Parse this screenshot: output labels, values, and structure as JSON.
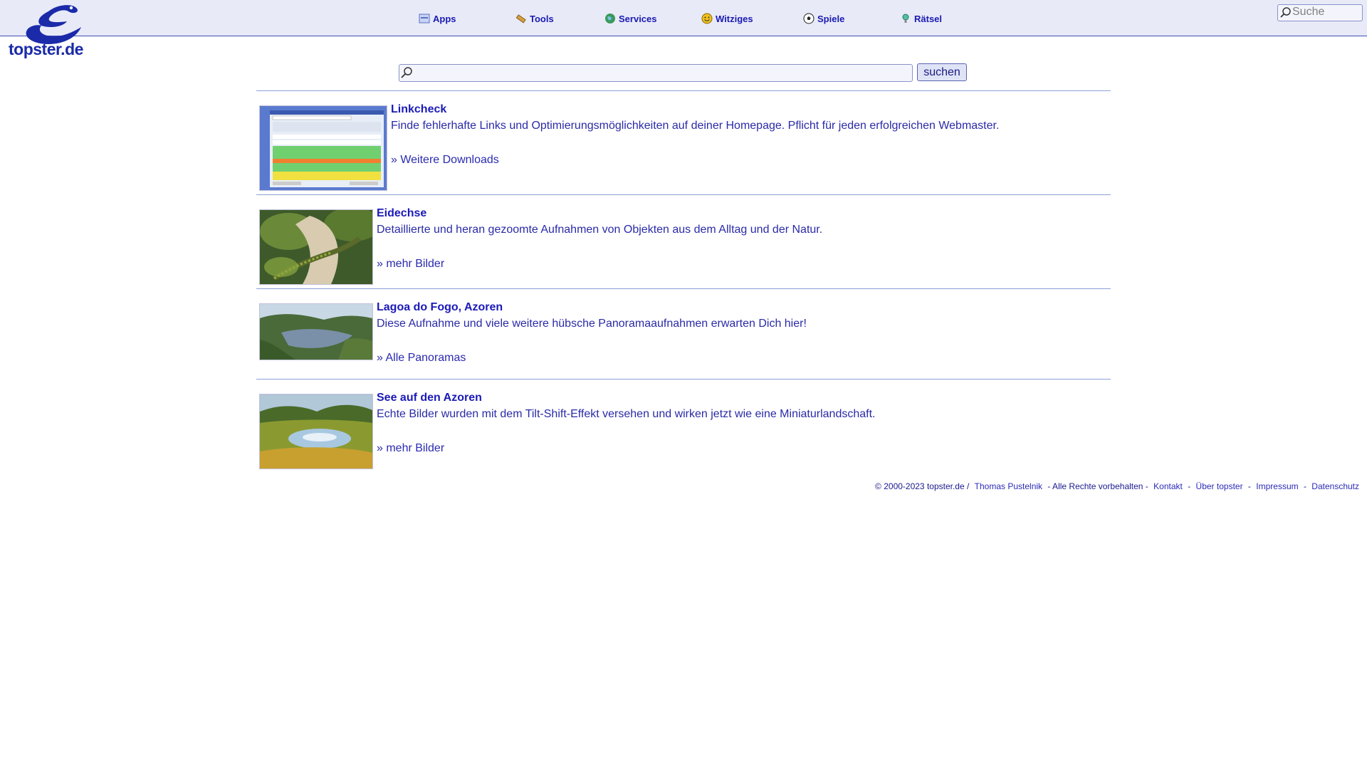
{
  "brand": {
    "logo_text": "topster.de"
  },
  "nav": [
    {
      "label": "Apps",
      "icon": "apps-icon"
    },
    {
      "label": "Tools",
      "icon": "tools-icon"
    },
    {
      "label": "Services",
      "icon": "globe-icon"
    },
    {
      "label": "Witziges",
      "icon": "smiley-icon"
    },
    {
      "label": "Spiele",
      "icon": "soccer-ball-icon"
    },
    {
      "label": "Rätsel",
      "icon": "lightbulb-icon"
    }
  ],
  "top_search": {
    "placeholder": "Suche"
  },
  "main_search": {
    "placeholder": "",
    "button_label": "suchen"
  },
  "entries": [
    {
      "title": "Linkcheck",
      "description": "Finde fehlerhafte Links und Optimierungsmöglichkeiten auf deiner Homepage. Pflicht für jeden erfolgreichen Webmaster.",
      "link": "» Weitere Downloads",
      "thumb": "linkcheck-screenshot"
    },
    {
      "title": "Eidechse",
      "description": "Detaillierte und heran gezoomte Aufnahmen von Objekten aus dem Alltag und der Natur.",
      "link": "» mehr Bilder",
      "thumb": "lizard-photo"
    },
    {
      "title": "Lagoa do Fogo, Azoren",
      "description": "Diese Aufnahme und viele weitere hübsche Panoramaaufnahmen erwarten Dich hier!",
      "link": "» Alle Panoramas",
      "thumb": "lake-panorama-photo"
    },
    {
      "title": "See auf den Azoren",
      "description": "Echte Bilder wurden mit dem Tilt-Shift-Effekt versehen und wirken jetzt wie eine Miniaturlandschaft.",
      "link": "» mehr Bilder",
      "thumb": "tilt-shift-lake-photo"
    }
  ],
  "footer": {
    "copyright": "© 2000-2023 topster.de /",
    "author": "Thomas Pustelnik",
    "rights": "- Alle Rechte vorbehalten -",
    "links": [
      "Kontakt",
      "Über topster",
      "Impressum",
      "Datenschutz"
    ],
    "separator": "-"
  }
}
